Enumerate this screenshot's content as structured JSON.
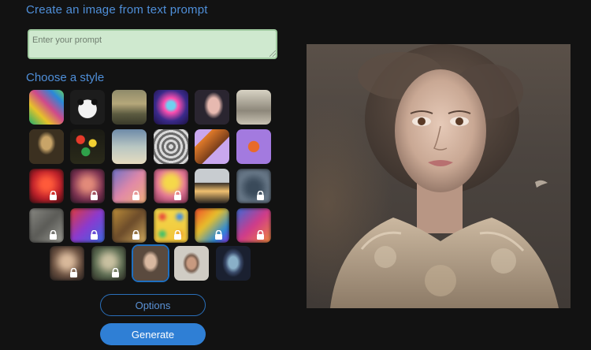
{
  "header": {
    "title": "Create an image from text prompt"
  },
  "prompt": {
    "placeholder": "Enter your prompt",
    "value": ""
  },
  "styles": {
    "heading": "Choose a style",
    "tiles": [
      {
        "name": "style-tile-1",
        "row": 0,
        "locked": false
      },
      {
        "name": "style-tile-2",
        "row": 0,
        "locked": false
      },
      {
        "name": "style-tile-3",
        "row": 0,
        "locked": false
      },
      {
        "name": "style-tile-4",
        "row": 0,
        "locked": false
      },
      {
        "name": "style-tile-5",
        "row": 0,
        "locked": true
      },
      {
        "name": "style-tile-6",
        "row": 0,
        "locked": false
      },
      {
        "name": "style-tile-7",
        "row": 1,
        "locked": false
      },
      {
        "name": "style-tile-8",
        "row": 1,
        "locked": false
      },
      {
        "name": "style-tile-9",
        "row": 1,
        "locked": false
      },
      {
        "name": "style-tile-10",
        "row": 1,
        "locked": false
      },
      {
        "name": "style-tile-11",
        "row": 1,
        "locked": false
      },
      {
        "name": "style-tile-12",
        "row": 1,
        "locked": false
      },
      {
        "name": "style-tile-13",
        "row": 2,
        "locked": true
      },
      {
        "name": "style-tile-14",
        "row": 2,
        "locked": true
      },
      {
        "name": "style-tile-15",
        "row": 2,
        "locked": true
      },
      {
        "name": "style-tile-16",
        "row": 2,
        "locked": true
      },
      {
        "name": "style-tile-17",
        "row": 2,
        "locked": false
      },
      {
        "name": "style-tile-18",
        "row": 2,
        "locked": true
      },
      {
        "name": "style-tile-19",
        "row": 3,
        "locked": true
      },
      {
        "name": "style-tile-20",
        "row": 3,
        "locked": true
      },
      {
        "name": "style-tile-21",
        "row": 3,
        "locked": true
      },
      {
        "name": "style-tile-22",
        "row": 3,
        "locked": true
      },
      {
        "name": "style-tile-23",
        "row": 3,
        "locked": true
      },
      {
        "name": "style-tile-24",
        "row": 3,
        "locked": true
      },
      {
        "name": "style-tile-25",
        "row": 4,
        "locked": true
      },
      {
        "name": "style-tile-26",
        "row": 4,
        "locked": true
      },
      {
        "name": "style-tile-27",
        "row": 4,
        "locked": false,
        "selected": true
      },
      {
        "name": "style-tile-28",
        "row": 4,
        "locked": false
      },
      {
        "name": "style-tile-29",
        "row": 4,
        "locked": false
      }
    ]
  },
  "actions": {
    "options_label": "Options",
    "generate_label": "Generate"
  },
  "colors": {
    "accent": "#2f7fd5",
    "heading": "#4f8fd9",
    "prompt_bg": "#cfe9cf",
    "background": "#121212"
  },
  "icons": {
    "lock": "lock-icon"
  }
}
